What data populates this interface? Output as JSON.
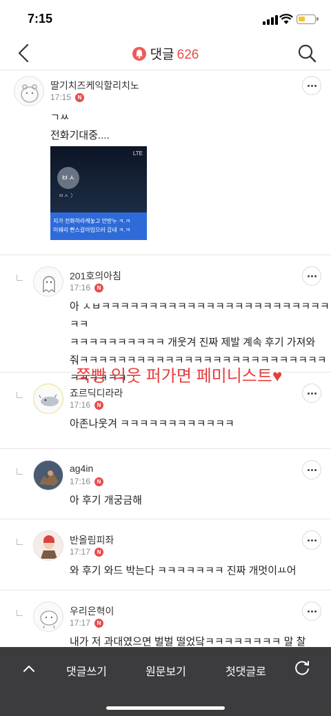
{
  "status_bar": {
    "time": "7:15"
  },
  "header": {
    "title": "댓글",
    "count": "626"
  },
  "comments": [
    {
      "author": "딸기치즈케익할리치노",
      "time": "17:15",
      "badge": "N",
      "lines": [
        "ㄱㅆ",
        "전화기대중...."
      ],
      "attachment": {
        "signal_text": "LTE",
        "contact": "ㅂㅅ",
        "contact_sub": "ㅂㅅ 〉",
        "message_line1": "지가 전화하라캐놓고 안받누 ㅋ.ㅋ",
        "message_line2": "이쉐리 빤스갈아입으러 갔네 ㅋ.ㅋ"
      }
    },
    {
      "author": "201호의아침",
      "time": "17:16",
      "badge": "N",
      "lines": [
        "아 ㅅㅂㅋㅋㅋㅋㅋㅋㅋㅋㅋㅋㅋㅋㅋㅋㅋㅋㅋㅋㅋㅋㅋㅋㅋㅋㅋㅋ",
        "ㅋㅋㅋㅋㅋㅋㅋㅋㅋㅋ 개웃겨 진짜 제발 계속 후기 가져와",
        "줘ㅋㅋㅋㅋㅋㅋㅋㅋㅋㅋㅋㅋㅋㅋㅋㅋㅋㅋㅋㅋㅋㅋㅋㅋㅋㅋ",
        "ㅋㅋㅋㅋㅋㅋ"
      ]
    },
    {
      "author": "죠르딕디라라",
      "time": "17:16",
      "badge": "N",
      "lines": [
        "아존나웃겨 ㅋㅋㅋㅋㅋㅋㅋㅋㅋㅋㅋㅋ"
      ]
    },
    {
      "author": "ag4in",
      "time": "17:16",
      "badge": "N",
      "lines": [
        "아 후기 개궁금해"
      ]
    },
    {
      "author": "반올림피좌",
      "time": "17:17",
      "badge": "N",
      "lines": [
        "와 후기 와드 박는다 ㅋㅋㅋㅋㅋㅋㅋ 진짜 개멋이ㅛ어"
      ]
    },
    {
      "author": "우리은혁이",
      "time": "17:17",
      "badge": "N",
      "lines": [
        "내가 저 과대였으면 벌벌 떨었닼ㅋㅋㅋㅋㅋㅋㅋㅋ 말 찰"
      ]
    }
  ],
  "overlay_text": "쭉빵 익웃 퍼가면 페미니스트♥",
  "bottom_bar": {
    "write": "댓글쓰기",
    "original": "원문보기",
    "first": "첫댓글로"
  },
  "colors": {
    "accent": "#e84c4c",
    "bottom_bar": "#3c3c3e"
  }
}
